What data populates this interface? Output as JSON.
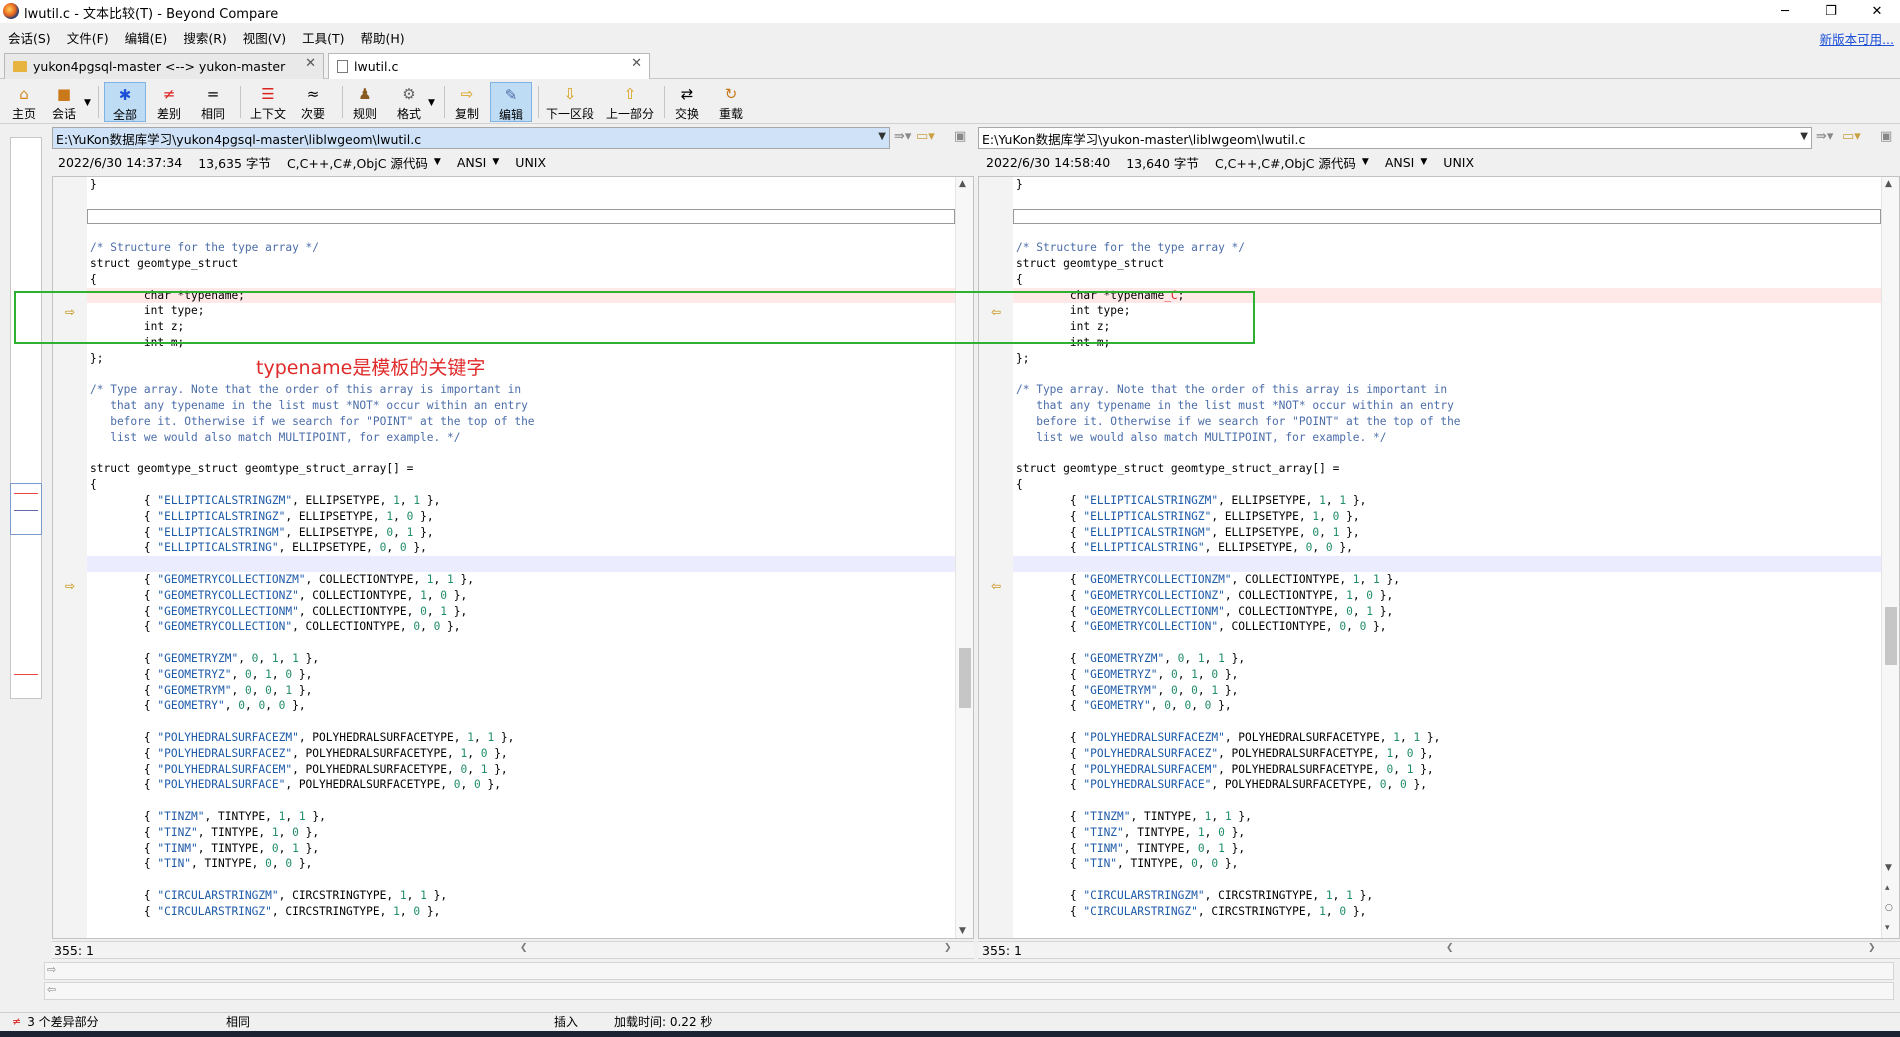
{
  "window": {
    "title": "lwutil.c - 文本比较(T) - Beyond Compare",
    "controls": {
      "minimize": "─",
      "maximize": "❐",
      "close": "✕"
    }
  },
  "menu": [
    "会话(S)",
    "文件(F)",
    "编辑(E)",
    "搜索(R)",
    "视图(V)",
    "工具(T)",
    "帮助(H)"
  ],
  "update_link": "新版本可用...",
  "session_tabs": [
    {
      "label": "yukon4pgsql-master <--> yukon-master",
      "close": "✕",
      "icon": "folder-icon"
    },
    {
      "label": "lwutil.c",
      "close": "✕",
      "icon": "document-icon"
    }
  ],
  "toolbar": {
    "home": "主页",
    "sessions": "会话",
    "all": "全部",
    "diffs": "差别",
    "same": "相同",
    "context": "上下文",
    "minor": "次要",
    "rules": "规则",
    "format": "格式",
    "copy": "复制",
    "edit": "编辑",
    "next_section": "下一区段",
    "prev_section": "上一部分",
    "swap": "交换",
    "reload": "重载"
  },
  "left": {
    "path": "E:\\YuKon数据库学习\\yukon4pgsql-master\\liblwgeom\\lwutil.c",
    "date": "2022/6/30 14:37:34",
    "size": "13,635 字节",
    "format": "C,C++,C#,ObjC 源代码",
    "encoding": "ANSI",
    "eol": "UNIX",
    "position": "355: 1",
    "changed_line": "        char *typename;"
  },
  "right": {
    "path": "E:\\YuKon数据库学习\\yukon-master\\liblwgeom\\lwutil.c",
    "date": "2022/6/30 14:58:40",
    "size": "13,640 字节",
    "format": "C,C++,C#,ObjC 源代码",
    "encoding": "ANSI",
    "eol": "UNIX",
    "position": "355: 1",
    "changed_line_prefix": "        char *typename",
    "changed_line_suffix": "_C",
    "changed_line_end": ";"
  },
  "code_lines": [
    "}",
    "",
    "",
    "",
    "/* Structure for the type array */",
    "struct geomtype_struct",
    "{",
    "@@DIFF@@",
    "        int type;",
    "        int z;",
    "        int m;",
    "};",
    "",
    "/* Type array. Note that the order of this array is important in",
    "   that any typename in the list must *NOT* occur within an entry",
    "   before it. Otherwise if we search for \"POINT\" at the top of the",
    "   list we would also match MULTIPOINT, for example. */",
    "",
    "struct geomtype_struct geomtype_struct_array[] =",
    "{",
    "        { \"ELLIPTICALSTRINGZM\", ELLIPSETYPE, 1, 1 },",
    "        { \"ELLIPTICALSTRINGZ\", ELLIPSETYPE, 1, 0 },",
    "        { \"ELLIPTICALSTRINGM\", ELLIPSETYPE, 0, 1 },",
    "        { \"ELLIPTICALSTRING\", ELLIPSETYPE, 0, 0 },",
    "",
    "        { \"GEOMETRYCOLLECTIONZM\", COLLECTIONTYPE, 1, 1 },",
    "        { \"GEOMETRYCOLLECTIONZ\", COLLECTIONTYPE, 1, 0 },",
    "        { \"GEOMETRYCOLLECTIONM\", COLLECTIONTYPE, 0, 1 },",
    "        { \"GEOMETRYCOLLECTION\", COLLECTIONTYPE, 0, 0 },",
    "",
    "        { \"GEOMETRYZM\", 0, 1, 1 },",
    "        { \"GEOMETRYZ\", 0, 1, 0 },",
    "        { \"GEOMETRYM\", 0, 0, 1 },",
    "        { \"GEOMETRY\", 0, 0, 0 },",
    "",
    "        { \"POLYHEDRALSURFACEZM\", POLYHEDRALSURFACETYPE, 1, 1 },",
    "        { \"POLYHEDRALSURFACEZ\", POLYHEDRALSURFACETYPE, 1, 0 },",
    "        { \"POLYHEDRALSURFACEM\", POLYHEDRALSURFACETYPE, 0, 1 },",
    "        { \"POLYHEDRALSURFACE\", POLYHEDRALSURFACETYPE, 0, 0 },",
    "",
    "        { \"TINZM\", TINTYPE, 1, 1 },",
    "        { \"TINZ\", TINTYPE, 1, 0 },",
    "        { \"TINM\", TINTYPE, 0, 1 },",
    "        { \"TIN\", TINTYPE, 0, 0 },",
    "",
    "        { \"CIRCULARSTRINGZM\", CIRCSTRINGTYPE, 1, 1 },",
    "        { \"CIRCULARSTRINGZ\", CIRCSTRINGTYPE, 1, 0 },"
  ],
  "status": {
    "diff_count": "3 个差异部分",
    "same": "相同",
    "insert": "插入",
    "load_time": "加载时间:  0.22 秒"
  },
  "annotation": "typename是模板的关键字",
  "colors": {
    "diff_bg": "#ffe8e8",
    "gap_bg": "#ececff",
    "annotation": "#e02a2a",
    "box": "#2fb030"
  }
}
